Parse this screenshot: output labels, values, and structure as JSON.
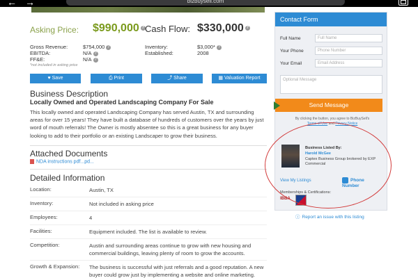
{
  "browser": {
    "url": "bizbuysell.com"
  },
  "listing": {
    "asking_price_label": "Asking Price:",
    "asking_price": "$990,000",
    "cash_flow_label": "Cash Flow:",
    "cash_flow": "$330,000",
    "gross_revenue_label": "Gross Revenue:",
    "gross_revenue": "$754,000",
    "ebitda_label": "EBITDA:",
    "ebitda": "N/A",
    "ffe_label": "FF&E:",
    "ffe": "N/A",
    "inventory_label": "Inventory:",
    "inventory": "$3,000*",
    "established_label": "Established:",
    "established": "2008",
    "note": "*not included in asking price"
  },
  "actions": {
    "save": "♥ Save",
    "print": "⎙ Print",
    "share": "⤴ Share",
    "valuation": "▦ Valuation Report"
  },
  "description": {
    "heading": "Business Description",
    "subheading": "Locally Owned and Operated Landscaping Company For Sale",
    "body": "This locally owned and operated Landscaping Company has served Austin, TX and surrounding areas for over 15 years! They have built a database of hundreds of customers over the years by just word of mouth referrals! The Owner is mostly absentee so this is a great business for any buyer looking to add to their portfolio or an existing Landscaper to grow their business."
  },
  "attached": {
    "heading": "Attached Documents",
    "doc": "NDA instructions pdf...pd..."
  },
  "details": {
    "heading": "Detailed Information",
    "rows": [
      {
        "k": "Location:",
        "v": "Austin, TX"
      },
      {
        "k": "Inventory:",
        "v": "Not included in asking price"
      },
      {
        "k": "Employees:",
        "v": "4"
      },
      {
        "k": "Facilities:",
        "v": "Equipment included. The list is available to review."
      },
      {
        "k": "Competition:",
        "v": "Austin and surrounding areas continue to grow with new housing and commercial buildings, leaving plenty of room to grow the accounts."
      },
      {
        "k": "Growth & Expansion:",
        "v": "The business is successful with just referrals and a good reputation. A new buyer could grow just by implementing a website and online marketing."
      }
    ]
  },
  "contact": {
    "title": "Contact Form",
    "full_name_label": "Full Name",
    "full_name_ph": "Full Name",
    "phone_label": "Your Phone",
    "phone_ph": "Phone Number",
    "email_label": "Your Email",
    "email_ph": "Email Address",
    "message_ph": "Optional Message",
    "send": "Send Message",
    "legal_pre": "By clicking the button, you agree to BizBuySell's",
    "legal_terms": "Terms of Use",
    "legal_and": " and ",
    "legal_privacy": "Privacy Notice",
    "listed_by": "Business Listed By:",
    "broker": "Harold McGee",
    "company": "Captex Business Group brokered by EXP Commercial",
    "view_listings": "View My Listings",
    "phone_btn": "Phone Number",
    "memberships": "Memberships & Certifications:",
    "ibba": "IBBA"
  },
  "report": "Report an issue with this listing"
}
